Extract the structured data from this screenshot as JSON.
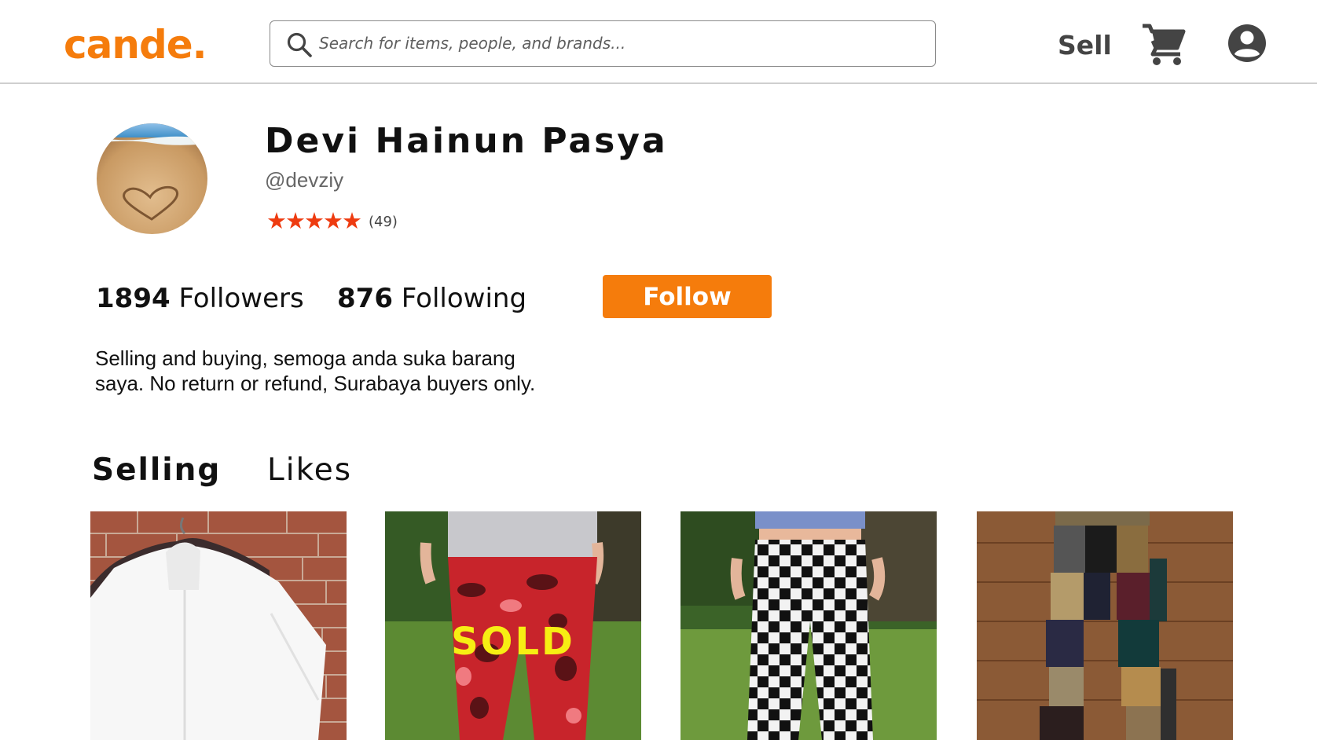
{
  "header": {
    "logo": "cande.",
    "search_placeholder": "Search for items, people, and brands...",
    "sell_label": "Sell",
    "icons": [
      "search-icon",
      "cart-icon",
      "account-icon"
    ]
  },
  "profile": {
    "name": "Devi Hainun Pasya",
    "handle": "@devziy",
    "stars": "★★★★★",
    "rating_count": "(49)",
    "followers_count": "1894",
    "followers_label": "Followers",
    "following_count": "876",
    "following_label": "Following",
    "follow_label": "Follow",
    "bio": "Selling and buying, semoga anda suka barang saya. No return or refund, Surabaya buyers only."
  },
  "tabs": [
    {
      "label": "Selling",
      "active": true
    },
    {
      "label": "Likes",
      "active": false
    }
  ],
  "listings": [
    {
      "subject": "white shirt on hanger",
      "sold": false
    },
    {
      "subject": "red camo pants",
      "sold": true,
      "sold_label": "SOLD"
    },
    {
      "subject": "checkered pants",
      "sold": false
    },
    {
      "subject": "patchwork corduroy pants",
      "sold": false
    }
  ],
  "colors": {
    "brand": "#f57c0c",
    "star": "#ee3b10",
    "sold": "#f7ee13"
  }
}
